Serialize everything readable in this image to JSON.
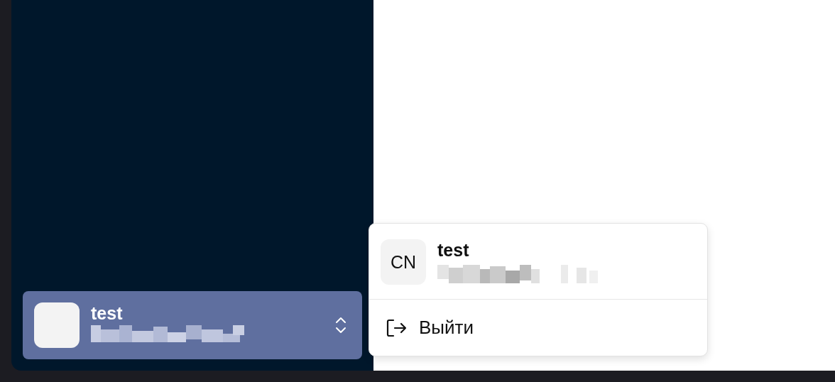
{
  "sidebar": {
    "user": {
      "name": "test"
    }
  },
  "user_menu": {
    "avatar_initials": "CN",
    "name": "test",
    "items": [
      {
        "label": "Выйти",
        "kind": "logout"
      }
    ]
  }
}
